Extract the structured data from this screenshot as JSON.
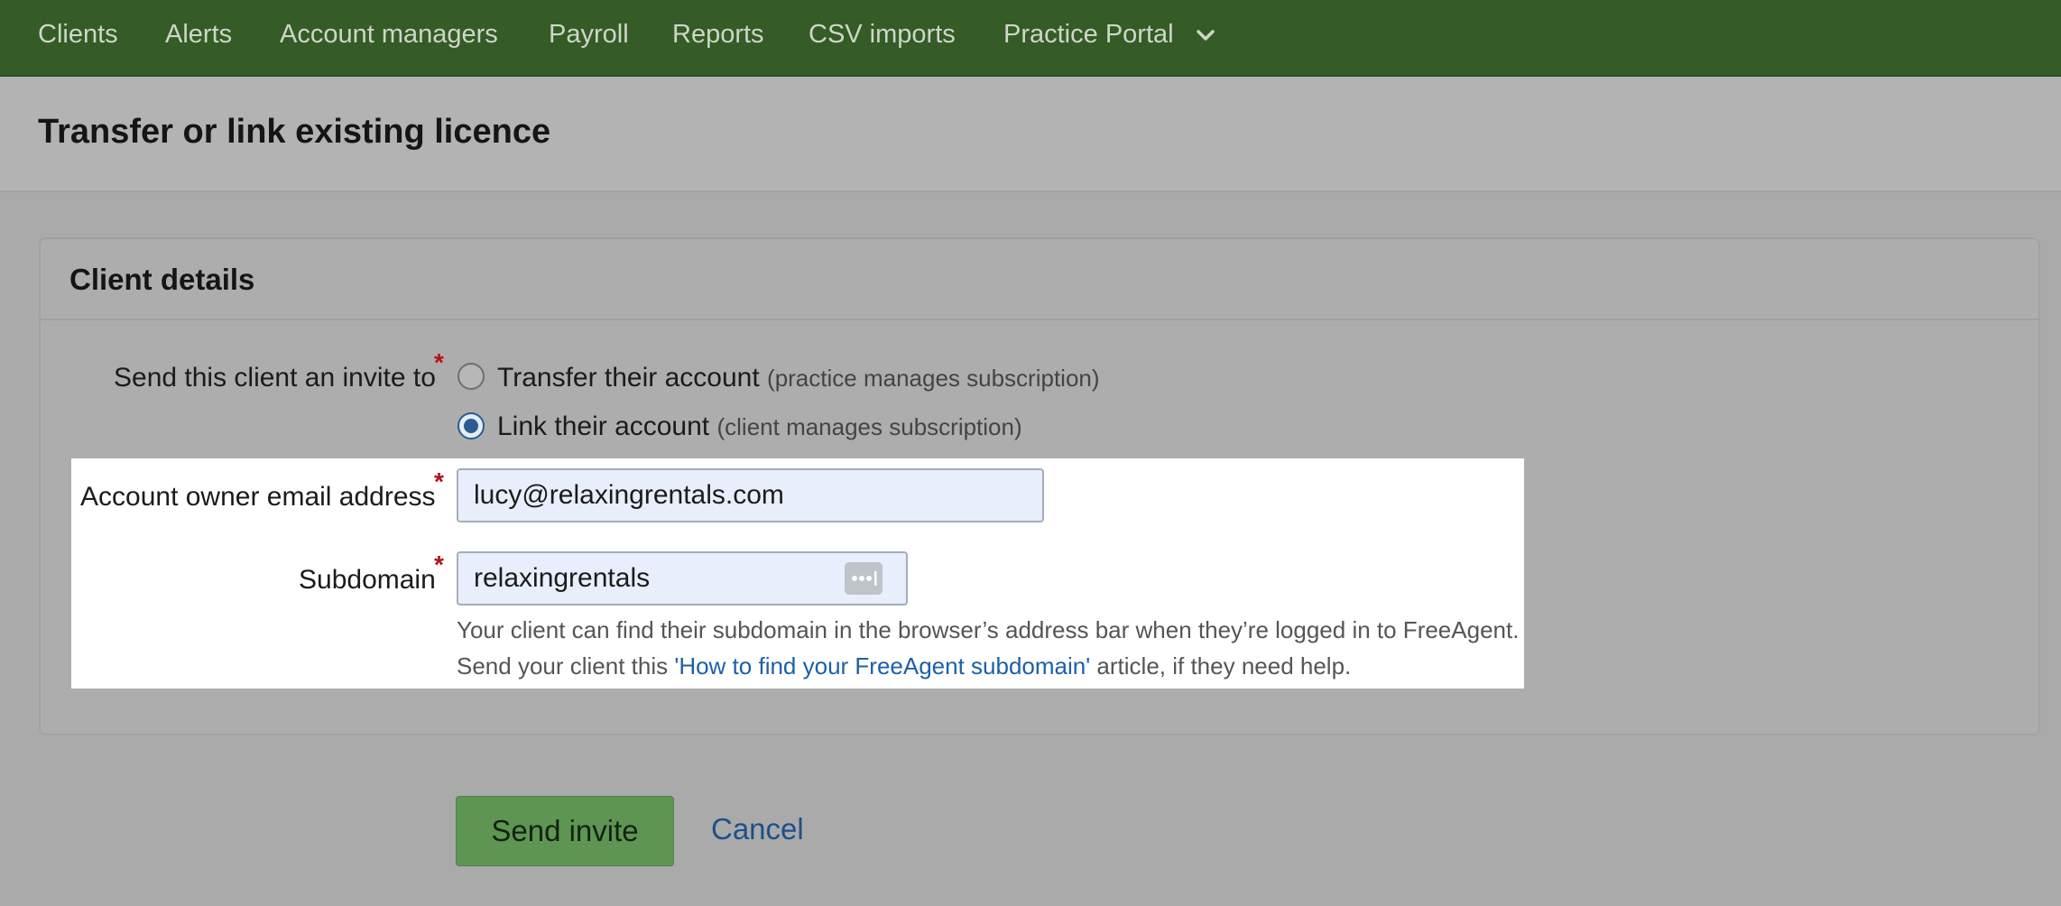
{
  "nav": {
    "items": [
      "Clients",
      "Alerts",
      "Account managers",
      "Payroll",
      "Reports",
      "CSV imports",
      "Practice Portal"
    ],
    "dropdown_icon": "chevron-down-icon"
  },
  "page": {
    "title": "Transfer or link existing licence"
  },
  "card": {
    "title": "Client details",
    "invite": {
      "label": "Send this client an invite to",
      "required_mark": "*",
      "options": [
        {
          "label": "Transfer their account",
          "sub": "(practice manages subscription)",
          "selected": false
        },
        {
          "label": "Link their account",
          "sub": "(client manages subscription)",
          "selected": true
        }
      ]
    },
    "email": {
      "label": "Account owner email address",
      "required_mark": "*",
      "value": "lucy@relaxingrentals.com"
    },
    "subdomain": {
      "label": "Subdomain",
      "required_mark": "*",
      "value": "relaxingrentals",
      "icon": "password-manager-icon",
      "help_line1": "Your client can find their subdomain in the browser’s address bar when they’re logged in to FreeAgent.",
      "help_line2_prefix": "Send your client this ",
      "help_link": "'How to find your FreeAgent subdomain'",
      "help_line2_suffix": " article, if they need help."
    }
  },
  "actions": {
    "send_label": "Send invite",
    "cancel_label": "Cancel"
  },
  "colors": {
    "nav_bg": "#355b26",
    "primary_button": "#5e9553",
    "link": "#1d5fa8",
    "required": "#b3131b"
  }
}
